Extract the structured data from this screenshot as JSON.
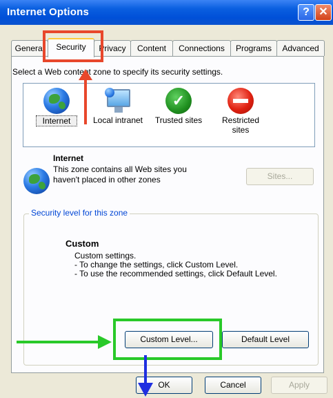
{
  "window": {
    "title": "Internet Options",
    "help_glyph": "?",
    "close_glyph": "✕"
  },
  "tabs": [
    {
      "label": "General"
    },
    {
      "label": "Security"
    },
    {
      "label": "Privacy"
    },
    {
      "label": "Content"
    },
    {
      "label": "Connections"
    },
    {
      "label": "Programs"
    },
    {
      "label": "Advanced"
    }
  ],
  "security": {
    "instruction": "Select a Web content zone to specify its security settings.",
    "zones": [
      {
        "label": "Internet",
        "icon": "globe-icon"
      },
      {
        "label": "Local intranet",
        "icon": "monitor-globe-icon"
      },
      {
        "label": "Trusted sites",
        "icon": "checkmark-icon"
      },
      {
        "label": "Restricted sites",
        "icon": "restricted-icon"
      }
    ],
    "selected_zone": {
      "name": "Internet",
      "description": "This zone contains all Web sites you haven't placed in other zones"
    },
    "sites_button": "Sites...",
    "level_group_label": "Security level for this zone",
    "level": {
      "title": "Custom",
      "lines": [
        "Custom settings.",
        "- To change the settings, click Custom Level.",
        "- To use the recommended settings, click Default Level."
      ]
    },
    "custom_level_button": "Custom Level...",
    "default_level_button": "Default Level"
  },
  "footer": {
    "ok": "OK",
    "cancel": "Cancel",
    "apply": "Apply"
  },
  "annotation_colors": {
    "red": "#e8472b",
    "green": "#29c929",
    "blue": "#1f2fe0"
  }
}
